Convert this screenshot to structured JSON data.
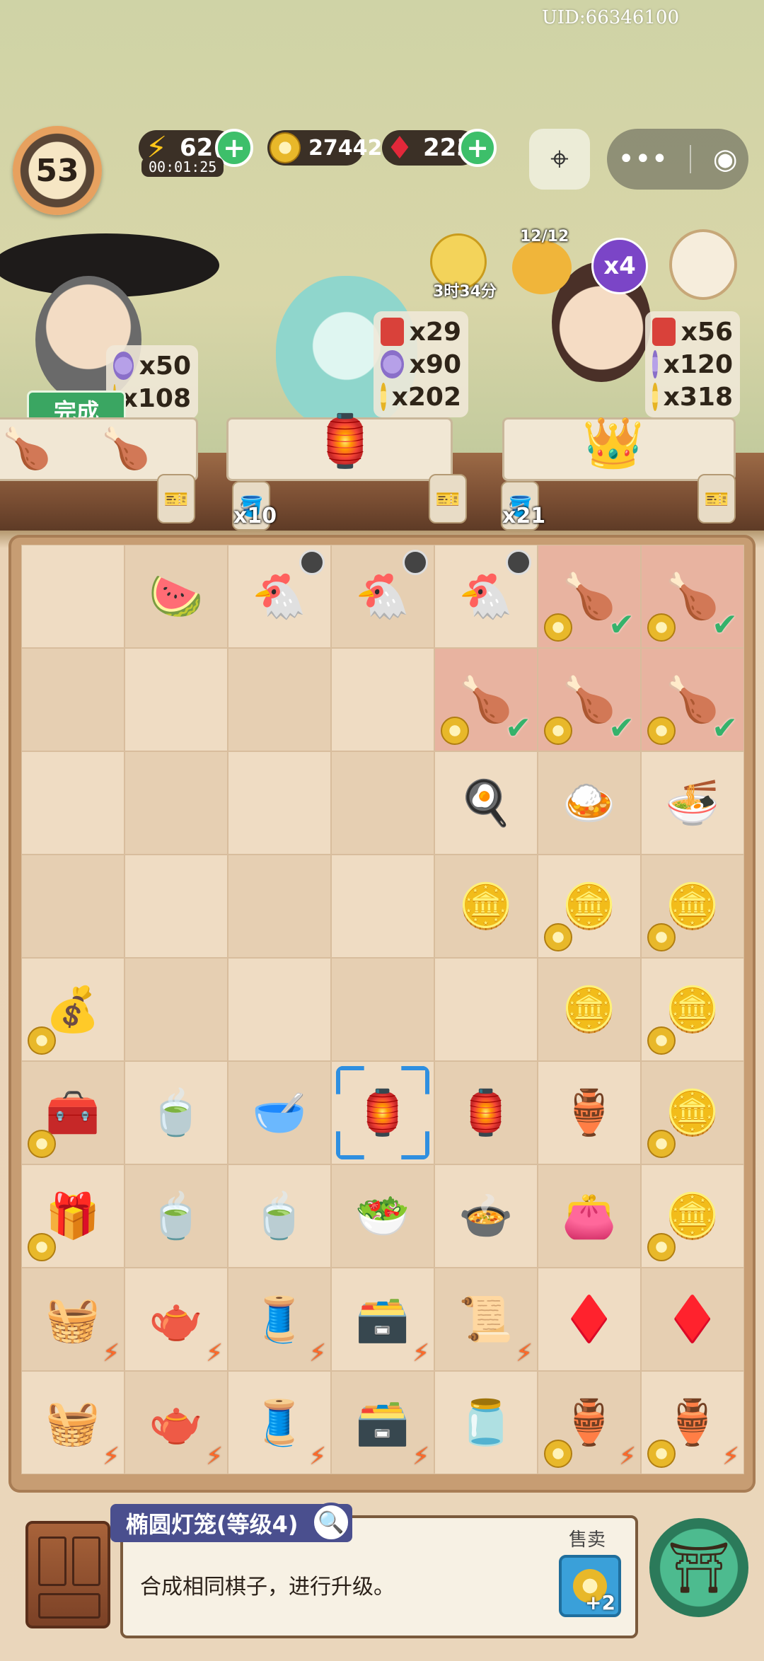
{
  "uid": "UID:66346100",
  "player": {
    "level": "53"
  },
  "resources": {
    "energy": "62",
    "energy_timer": "00:01:25",
    "coins": "27442",
    "gems": "223"
  },
  "customers": [
    {
      "id": "left",
      "orders": [
        {
          "icon": "flower-icon",
          "qty": "x50"
        },
        {
          "icon": "coin-icon",
          "qty": "x108"
        }
      ],
      "finish_label": "完成",
      "counter_mult": "x10"
    },
    {
      "id": "middle",
      "orders": [
        {
          "icon": "ticket-icon",
          "qty": "x29"
        },
        {
          "icon": "flower-icon",
          "qty": "x90"
        },
        {
          "icon": "coin-icon",
          "qty": "x202"
        }
      ],
      "bubble_time": "3时34分",
      "counter_mult": "x21"
    },
    {
      "id": "right",
      "orders": [
        {
          "icon": "ticket-icon",
          "qty": "x56"
        },
        {
          "icon": "flower-icon",
          "qty": "x120"
        },
        {
          "icon": "coin-icon",
          "qty": "x318"
        }
      ],
      "bubble_count": "12/12",
      "boost": "x4"
    }
  ],
  "board": {
    "rows": [
      [
        {
          "e": ""
        },
        {
          "e": "🍉",
          "n": "fruit-plate"
        },
        {
          "e": "🐔",
          "n": "chicken-nest",
          "clock": true
        },
        {
          "e": "🐔",
          "n": "chicken-nest",
          "clock": true
        },
        {
          "e": "🐔",
          "n": "chicken-nest",
          "clock": true
        },
        {
          "e": "🍗",
          "n": "roast-chicken",
          "coin": true,
          "check": true,
          "done": true
        },
        {
          "e": "🍗",
          "n": "roast-chicken",
          "coin": true,
          "check": true,
          "done": true
        }
      ],
      [
        {
          "e": ""
        },
        {
          "e": ""
        },
        {
          "e": ""
        },
        {
          "e": ""
        },
        {
          "e": "🍗",
          "n": "roast-chicken",
          "coin": true,
          "check": true,
          "done": true
        },
        {
          "e": "🍗",
          "n": "roast-chicken",
          "coin": true,
          "check": true,
          "done": true
        },
        {
          "e": "🍗",
          "n": "roast-chicken",
          "coin": true,
          "check": true,
          "done": true
        }
      ],
      [
        {
          "e": ""
        },
        {
          "e": ""
        },
        {
          "e": ""
        },
        {
          "e": ""
        },
        {
          "e": "🍳",
          "n": "fried-egg"
        },
        {
          "e": "🍛",
          "n": "egg-rice"
        },
        {
          "e": "🍜",
          "n": "chicken-bowl"
        }
      ],
      [
        {
          "e": ""
        },
        {
          "e": ""
        },
        {
          "e": ""
        },
        {
          "e": ""
        },
        {
          "e": "🪙",
          "n": "coin-single"
        },
        {
          "e": "🪙",
          "n": "coin-pile",
          "coin": true
        },
        {
          "e": "🪙",
          "n": "coin-pile",
          "coin": true
        }
      ],
      [
        {
          "e": "💰",
          "n": "mystery-bag",
          "coin": true
        },
        {
          "e": ""
        },
        {
          "e": ""
        },
        {
          "e": ""
        },
        {
          "e": ""
        },
        {
          "e": "🪙",
          "n": "coin-stack"
        },
        {
          "e": "🪙",
          "n": "coin-pile",
          "coin": true
        }
      ],
      [
        {
          "e": "🧰",
          "n": "treasure-chest",
          "coin": true
        },
        {
          "e": "🍵",
          "n": "tea-cup"
        },
        {
          "e": "🥣",
          "n": "porridge-bowl"
        },
        {
          "e": "🏮",
          "n": "oval-lantern",
          "selected": true
        },
        {
          "e": "🏮",
          "n": "palace-lantern"
        },
        {
          "e": "🏺",
          "n": "flower-vase"
        },
        {
          "e": "🪙",
          "n": "coin-pile",
          "coin": true
        }
      ],
      [
        {
          "e": "🎁",
          "n": "red-gift-box",
          "coin": true
        },
        {
          "e": "🍵",
          "n": "tea-dish"
        },
        {
          "e": "🍵",
          "n": "green-tea"
        },
        {
          "e": "🥗",
          "n": "bean-soup"
        },
        {
          "e": "🍲",
          "n": "red-bean-soup"
        },
        {
          "e": "👛",
          "n": "purple-pouch"
        },
        {
          "e": "🪙",
          "n": "coin-pile",
          "coin": true
        }
      ],
      [
        {
          "e": "🧺",
          "n": "fruit-basket",
          "bolt": true
        },
        {
          "e": "🫖",
          "n": "teapot-stove",
          "bolt": true
        },
        {
          "e": "🧵",
          "n": "loom",
          "bolt": true
        },
        {
          "e": "🗃️",
          "n": "jewelry-box",
          "bolt": true
        },
        {
          "e": "📜",
          "n": "scroll-set",
          "bolt": true
        },
        {
          "e": "♦️",
          "n": "red-gems"
        },
        {
          "e": "♦️",
          "n": "red-gem"
        }
      ],
      [
        {
          "e": "🧺",
          "n": "food-basket",
          "bolt": true
        },
        {
          "e": "🫖",
          "n": "blue-teapot",
          "bolt": true
        },
        {
          "e": "🧵",
          "n": "spinning-wheel",
          "bolt": true
        },
        {
          "e": "🗃️",
          "n": "open-chest",
          "bolt": true
        },
        {
          "e": "🫙",
          "n": "tea-jar"
        },
        {
          "e": "🏺",
          "n": "lucky-pot",
          "coin": true,
          "bolt": true
        },
        {
          "e": "🏺",
          "n": "lucky-pot",
          "coin": true,
          "bolt": true
        }
      ]
    ]
  },
  "info_panel": {
    "title": "椭圆灯笼(等级4)",
    "description": "合成相同棋子，进行升级。",
    "sell_label": "售卖",
    "sell_value": "+2"
  }
}
